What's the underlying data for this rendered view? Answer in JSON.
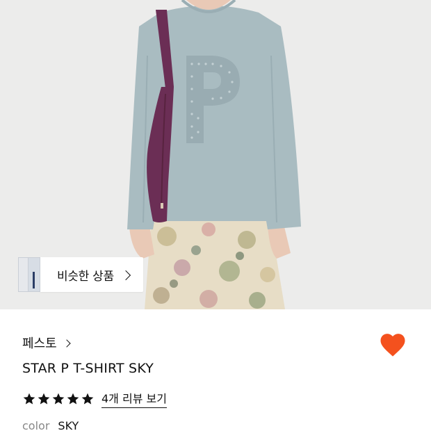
{
  "similar_products": {
    "label": "비슷한 상품"
  },
  "product": {
    "brand": "페스토",
    "name": "STAR P T-SHIRT SKY",
    "rating_stars": 5,
    "review_link": "4개 리뷰 보기",
    "color_label": "color",
    "color_value": "SKY",
    "wishlisted": true
  },
  "colors": {
    "heart": "#f4511e",
    "shirt": "#a9bcc1",
    "bag": "#6b2e55",
    "background": "#ececeb"
  },
  "icons": {
    "brand_chevron": "chevron-right-icon",
    "similar_chevron": "chevron-right-icon",
    "wishlist": "heart-icon",
    "star": "star-icon"
  }
}
